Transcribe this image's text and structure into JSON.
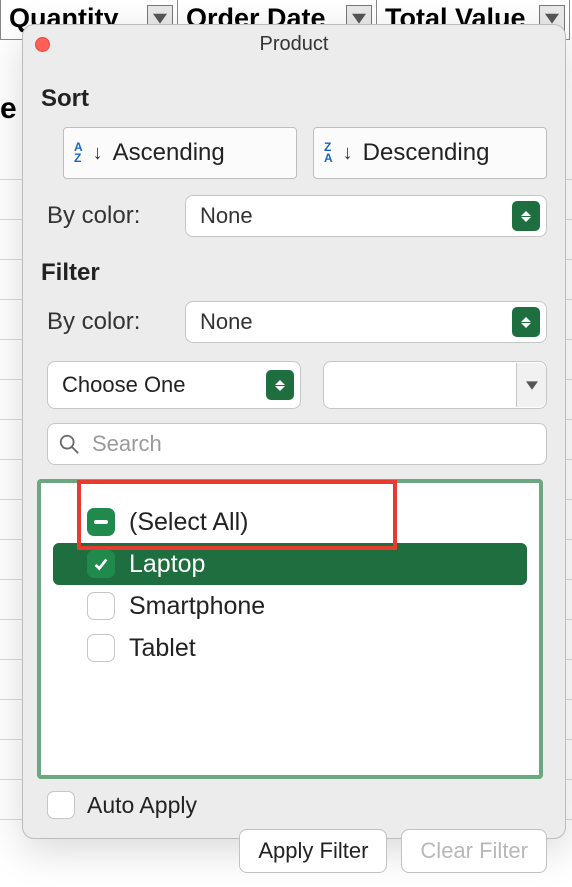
{
  "spreadsheet": {
    "columns": [
      "Quantity",
      "Order Date",
      "Total Value"
    ],
    "row_label_fragment": "e"
  },
  "dialog": {
    "title": "Product",
    "sections": {
      "sort": "Sort",
      "filter": "Filter"
    },
    "sort": {
      "asc": "Ascending",
      "desc": "Descending",
      "by_color_label": "By color:",
      "by_color_value": "None"
    },
    "filter": {
      "by_color_label": "By color:",
      "by_color_value": "None",
      "choose_one": "Choose One",
      "combo_value": "",
      "search_placeholder": "Search",
      "items": [
        {
          "label": "(Select All)",
          "state": "half"
        },
        {
          "label": "Laptop",
          "state": "checked",
          "selected": true
        },
        {
          "label": "Smartphone",
          "state": "unchecked"
        },
        {
          "label": "Tablet",
          "state": "unchecked"
        }
      ],
      "auto_apply": "Auto Apply",
      "apply": "Apply Filter",
      "clear": "Clear Filter"
    }
  }
}
